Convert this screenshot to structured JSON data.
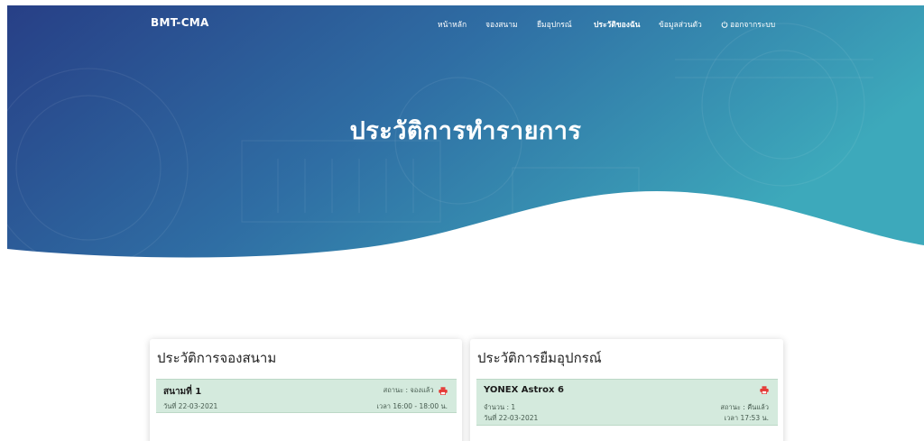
{
  "nav": {
    "brand": "BMT-CMA",
    "items": [
      {
        "label": "หน้าหลัก"
      },
      {
        "label": "จองสนาม"
      },
      {
        "label": "ยืมอุปกรณ์"
      },
      {
        "label": "ประวัติของฉัน"
      },
      {
        "label": "ข้อมูลส่วนตัว"
      },
      {
        "label": "ออกจากระบบ",
        "icon": "power-icon"
      }
    ],
    "active_index": 3
  },
  "hero": {
    "title": "ประวัติการทำรายการ"
  },
  "booking_history": {
    "title": "ประวัติการจองสนาม",
    "entries": [
      {
        "court": "สนามที่ 1",
        "status": "สถานะ : จองแล้ว",
        "date": "วันที่ 22-03-2021",
        "time": "เวลา 16:00 - 18:00 น."
      }
    ]
  },
  "borrow_history": {
    "title": "ประวัติการยืมอุปกรณ์",
    "entries": [
      {
        "item": "YONEX Astrox 6",
        "quantity": "จำนวน : 1",
        "date": "วันที่ 22-03-2021",
        "status": "สถานะ : คืนแล้ว",
        "time": "เวลา 17:53 น."
      }
    ]
  },
  "colors": {
    "hero_gradient_start": "#273f86",
    "hero_gradient_end": "#3da3b8",
    "entry_background": "#d4eadd",
    "print_icon": "#e53935"
  }
}
